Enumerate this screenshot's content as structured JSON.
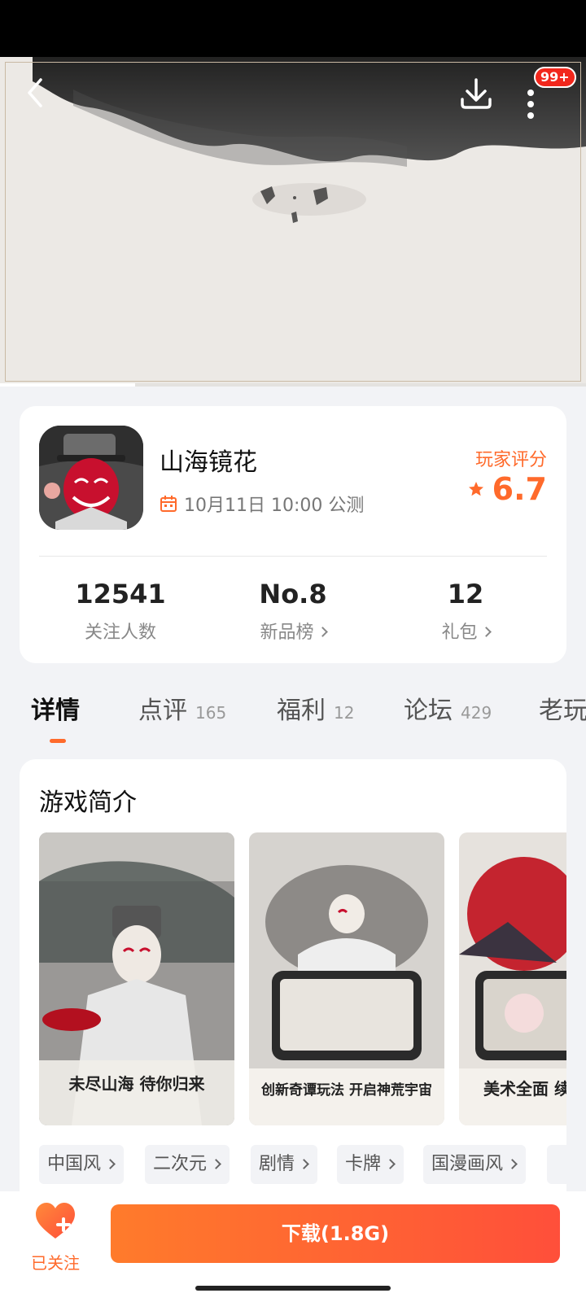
{
  "hero": {
    "banner_text": "",
    "progress_fraction": 0.23,
    "badge": "99+"
  },
  "game": {
    "name": "山海镜花",
    "release_text": "10月11日 10:00 公测",
    "rating_label": "玩家评分",
    "rating_value": "6.7"
  },
  "stats": [
    {
      "value": "12541",
      "label": "关注人数"
    },
    {
      "value": "No.8",
      "label": "新品榜"
    },
    {
      "value": "12",
      "label": "礼包"
    }
  ],
  "tabs": [
    {
      "label": "详情",
      "count": ""
    },
    {
      "label": "点评",
      "count": "165"
    },
    {
      "label": "福利",
      "count": "12"
    },
    {
      "label": "论坛",
      "count": "429"
    },
    {
      "label": "老玩",
      "count": ""
    }
  ],
  "intro": {
    "title": "游戏简介",
    "screenshots": [
      {
        "caption": "未尽山海 待你归来"
      },
      {
        "caption": "创新奇谭玩法 开启神荒宇宙"
      },
      {
        "caption": "美术全面 续写妖"
      }
    ],
    "tags": [
      "中国风",
      "二次元",
      "剧情",
      "卡牌",
      "国漫画风"
    ]
  },
  "bottom": {
    "follow_label": "已关注",
    "download_label": "下载(1.8G)"
  },
  "colors": {
    "accent": "#ff6a2b",
    "badge": "#f2271c"
  },
  "icons": {
    "back": "back-arrow-icon",
    "download": "download-icon",
    "more": "more-vertical-icon",
    "calendar": "calendar-icon",
    "star": "star-icon",
    "follow": "heart-plus-icon"
  }
}
